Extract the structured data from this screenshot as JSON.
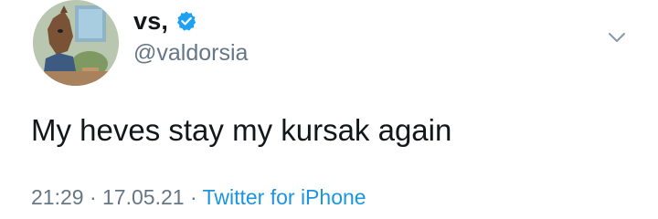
{
  "tweet": {
    "display_name": "vs,",
    "handle": "@valdorsia",
    "verified": true,
    "text": "My heves stay my kursak again",
    "time": "21:29",
    "separator": "·",
    "date": "17.05.21",
    "source": "Twitter for iPhone"
  },
  "icons": {
    "verified": "verified-badge-icon",
    "more": "chevron-down-icon",
    "avatar": "profile-picture"
  },
  "colors": {
    "text": "#14171a",
    "secondary": "#657786",
    "link": "#1b95e0",
    "verified": "#1da1f2"
  }
}
